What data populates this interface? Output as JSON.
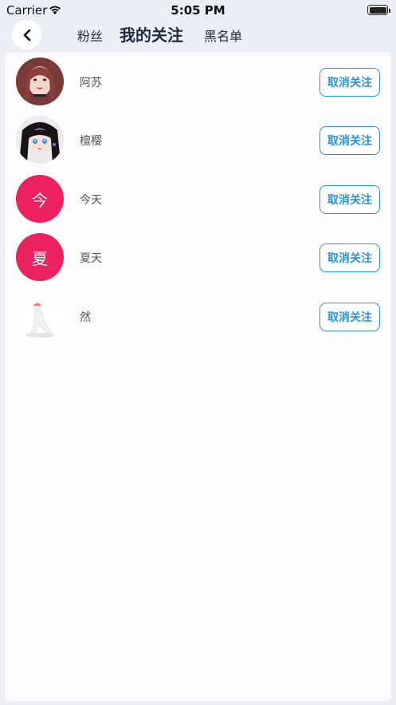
{
  "status": {
    "carrier": "Carrier",
    "time": "5:05 PM"
  },
  "nav": {
    "tabs": [
      {
        "label": "粉丝"
      },
      {
        "label": "我的关注"
      },
      {
        "label": "黑名单"
      }
    ]
  },
  "list": {
    "items": [
      {
        "name": "阿苏",
        "avatar": "photo-girl-pink",
        "button": "取消关注"
      },
      {
        "name": "檀樱",
        "avatar": "photo-anime-girl",
        "button": "取消关注"
      },
      {
        "name": "今天",
        "avatar_letter": "今",
        "button": "取消关注"
      },
      {
        "name": "夏天",
        "avatar_letter": "夏",
        "button": "取消关注"
      },
      {
        "name": "然",
        "avatar": "photo-3d-figure",
        "button": "取消关注"
      }
    ]
  },
  "colors": {
    "accent": "#2C93D6",
    "avatar_bg": "#EB2160",
    "page_bg": "#ECEEF5"
  }
}
